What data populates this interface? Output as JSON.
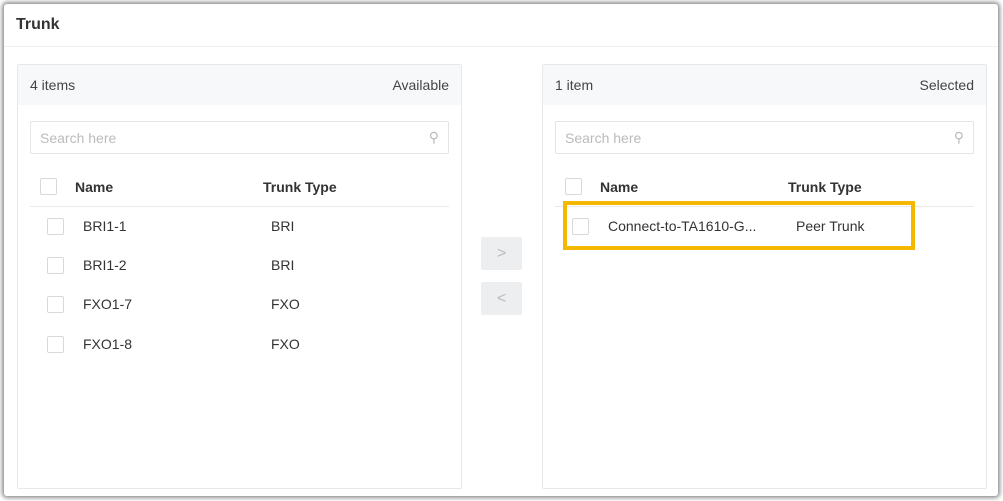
{
  "title": "Trunk",
  "available": {
    "count": "4 items",
    "label": "Available",
    "search_placeholder": "Search here",
    "columns": [
      "Name",
      "Trunk Type"
    ],
    "rows": [
      {
        "name": "BRI1-1",
        "type": "BRI"
      },
      {
        "name": "BRI1-2",
        "type": "BRI"
      },
      {
        "name": "FXO1-7",
        "type": "FXO"
      },
      {
        "name": "FXO1-8",
        "type": "FXO"
      }
    ]
  },
  "selected": {
    "count": "1 item",
    "label": "Selected",
    "search_placeholder": "Search here",
    "columns": [
      "Name",
      "Trunk Type"
    ],
    "rows": [
      {
        "name": "Connect-to-TA1610-G...",
        "type": "Peer Trunk"
      }
    ]
  },
  "transfer": {
    "right": ">",
    "left": "<"
  },
  "highlight_color": "#f5b800"
}
